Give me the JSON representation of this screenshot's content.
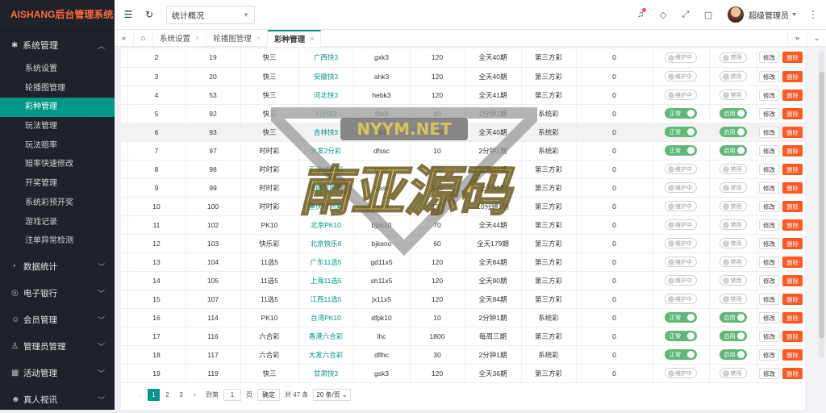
{
  "app_title": "AISHANG后台管理系统",
  "sidebar": {
    "group": {
      "label": "系统管理",
      "icon": "gear-icon"
    },
    "items": [
      {
        "label": "系统设置",
        "active": false
      },
      {
        "label": "轮播图管理",
        "active": false
      },
      {
        "label": "彩种管理",
        "active": true
      },
      {
        "label": "玩法管理",
        "active": false
      },
      {
        "label": "玩法赔率",
        "active": false
      },
      {
        "label": "赔率快速修改",
        "active": false
      },
      {
        "label": "开奖管理",
        "active": false
      },
      {
        "label": "系统彩预开奖",
        "active": false
      },
      {
        "label": "游戏记录",
        "active": false
      },
      {
        "label": "注单异常检测",
        "active": false
      }
    ],
    "groups": [
      {
        "label": "数据统计",
        "icon": "chart-icon"
      },
      {
        "label": "电子银行",
        "icon": "coin-icon"
      },
      {
        "label": "会员管理",
        "icon": "users-icon"
      },
      {
        "label": "管理员管理",
        "icon": "user-icon"
      },
      {
        "label": "活动管理",
        "icon": "calendar-icon"
      },
      {
        "label": "真人视讯",
        "icon": "people-icon"
      }
    ]
  },
  "header": {
    "select_value": "统计概况",
    "user_name": "超级管理员"
  },
  "tabs": [
    {
      "label": "系统设置",
      "active": false
    },
    {
      "label": "轮播图管理",
      "active": false
    },
    {
      "label": "彩种管理",
      "active": true
    }
  ],
  "table": {
    "switch_off_status": "维护中",
    "switch_on_status": "正常",
    "switch_off_enable": "禁用",
    "switch_on_enable": "启用",
    "edit_label": "修改",
    "delete_label": "删除",
    "rows": [
      {
        "no": "2",
        "id": "19",
        "type": "快三",
        "name": "广西快3",
        "code": "gxk3",
        "secs": "120",
        "period": "全天40期",
        "source": "第三方彩",
        "sort": "0",
        "on": false
      },
      {
        "no": "3",
        "id": "20",
        "type": "快三",
        "name": "安徽快3",
        "code": "ahk3",
        "secs": "120",
        "period": "全天40期",
        "source": "第三方彩",
        "sort": "0",
        "on": false
      },
      {
        "no": "4",
        "id": "53",
        "type": "快三",
        "name": "河北快3",
        "code": "hebk3",
        "secs": "120",
        "period": "全天41期",
        "source": "第三方彩",
        "sort": "0",
        "on": false
      },
      {
        "no": "5",
        "id": "92",
        "type": "快三",
        "name": "1分快3",
        "code": "f1k3",
        "secs": "10",
        "period": "1分钟1期",
        "source": "系统彩",
        "sort": "0",
        "on": true
      },
      {
        "no": "6",
        "id": "93",
        "type": "快三",
        "name": "吉林快3",
        "code": "jlk3",
        "secs": "120",
        "period": "全天40期",
        "source": "系统彩",
        "sort": "0",
        "on": true,
        "hl": true
      },
      {
        "no": "7",
        "id": "97",
        "type": "时时彩",
        "name": "大发2分彩",
        "code": "dfssc",
        "secs": "10",
        "period": "2分钟1期",
        "source": "系统彩",
        "sort": "0",
        "on": true
      },
      {
        "no": "8",
        "id": "98",
        "type": "时时彩",
        "name": "天津时时彩",
        "code": "tjssc",
        "secs": "120",
        "period": "全天84期",
        "source": "第三方彩",
        "sort": "0",
        "on": false
      },
      {
        "no": "9",
        "id": "99",
        "type": "时时彩",
        "name": "新疆时时彩",
        "code": "xjssc",
        "secs": "120",
        "period": "全天96期",
        "source": "第三方彩",
        "sort": "0",
        "on": false
      },
      {
        "no": "10",
        "id": "100",
        "type": "时时彩",
        "name": "重庆时时彩",
        "code": "cqssc",
        "secs": "120",
        "period": "10分钟1期",
        "source": "第三方彩",
        "sort": "0",
        "on": false
      },
      {
        "no": "11",
        "id": "102",
        "type": "PK10",
        "name": "北京PK10",
        "code": "bjpk10",
        "secs": "70",
        "period": "全天44期",
        "source": "第三方彩",
        "sort": "0",
        "on": false
      },
      {
        "no": "12",
        "id": "103",
        "type": "快乐彩",
        "name": "北京快乐8",
        "code": "bjkeno",
        "secs": "60",
        "period": "全天179期",
        "source": "第三方彩",
        "sort": "0",
        "on": false
      },
      {
        "no": "13",
        "id": "104",
        "type": "11选5",
        "name": "广东11选5",
        "code": "gd11x5",
        "secs": "120",
        "period": "全天84期",
        "source": "第三方彩",
        "sort": "0",
        "on": false
      },
      {
        "no": "14",
        "id": "105",
        "type": "11选5",
        "name": "上海11选5",
        "code": "sh11x5",
        "secs": "120",
        "period": "全天90期",
        "source": "第三方彩",
        "sort": "0",
        "on": false
      },
      {
        "no": "15",
        "id": "107",
        "type": "11选5",
        "name": "江西11选5",
        "code": "jx11x5",
        "secs": "120",
        "period": "全天84期",
        "source": "第三方彩",
        "sort": "0",
        "on": false
      },
      {
        "no": "16",
        "id": "114",
        "type": "PK10",
        "name": "台湾PK10",
        "code": "dfpk10",
        "secs": "10",
        "period": "2分钟1期",
        "source": "系统彩",
        "sort": "0",
        "on": true
      },
      {
        "no": "17",
        "id": "116",
        "type": "六合彩",
        "name": "香港六合彩",
        "code": "lhc",
        "secs": "1800",
        "period": "每周三期",
        "source": "第三方彩",
        "sort": "0",
        "on": true
      },
      {
        "no": "18",
        "id": "117",
        "type": "六合彩",
        "name": "大发六合彩",
        "code": "dflhc",
        "secs": "30",
        "period": "2分钟1期",
        "source": "系统彩",
        "sort": "0",
        "on": true
      },
      {
        "no": "19",
        "id": "119",
        "type": "快三",
        "name": "甘肃快3",
        "code": "gsk3",
        "secs": "120",
        "period": "全天36期",
        "source": "第三方彩",
        "sort": "0",
        "on": false
      }
    ]
  },
  "pagination": {
    "pages": [
      "1",
      "2",
      "3"
    ],
    "current": "1",
    "goto_label": "到第",
    "input_value": "1",
    "page_unit": "页",
    "confirm_label": "确定",
    "total_label": "共 47 条",
    "size_label": "20 条/页"
  },
  "watermark": {
    "line1": "NYYM.NET",
    "line2": "南亚源码"
  }
}
